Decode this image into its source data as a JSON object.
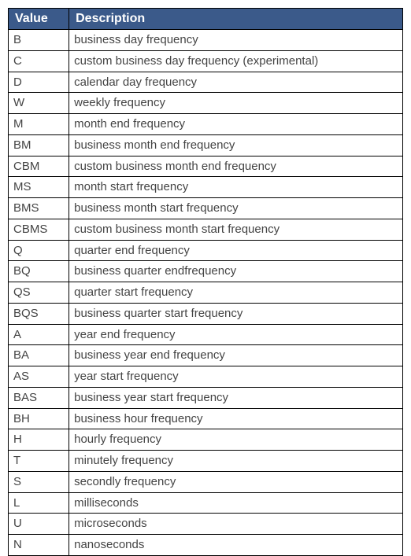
{
  "table": {
    "headers": {
      "value": "Value",
      "description": "Description"
    },
    "rows": [
      {
        "value": "B",
        "description": "business day frequency"
      },
      {
        "value": "C",
        "description": "custom business day frequency (experimental)"
      },
      {
        "value": "D",
        "description": "calendar day frequency"
      },
      {
        "value": "W",
        "description": "weekly frequency"
      },
      {
        "value": "M",
        "description": "month end frequency"
      },
      {
        "value": "BM",
        "description": "business month end frequency"
      },
      {
        "value": "CBM",
        "description": "custom business month end frequency"
      },
      {
        "value": "MS",
        "description": "month start frequency"
      },
      {
        "value": "BMS",
        "description": "business month start frequency"
      },
      {
        "value": "CBMS",
        "description": "custom business month start frequency"
      },
      {
        "value": "Q",
        "description": "quarter end frequency"
      },
      {
        "value": "BQ",
        "description": "business quarter endfrequency"
      },
      {
        "value": "QS",
        "description": "quarter start frequency"
      },
      {
        "value": "BQS",
        "description": "business quarter start frequency"
      },
      {
        "value": "A",
        "description": "year end frequency"
      },
      {
        "value": "BA",
        "description": "business year end frequency"
      },
      {
        "value": "AS",
        "description": "year start frequency"
      },
      {
        "value": "BAS",
        "description": "business year start frequency"
      },
      {
        "value": "BH",
        "description": "business hour frequency"
      },
      {
        "value": "H",
        "description": "hourly frequency"
      },
      {
        "value": "T",
        "description": "minutely frequency"
      },
      {
        "value": "S",
        "description": "secondly frequency"
      },
      {
        "value": "L",
        "description": "milliseconds"
      },
      {
        "value": "U",
        "description": "microseconds"
      },
      {
        "value": "N",
        "description": "nanoseconds"
      }
    ]
  }
}
